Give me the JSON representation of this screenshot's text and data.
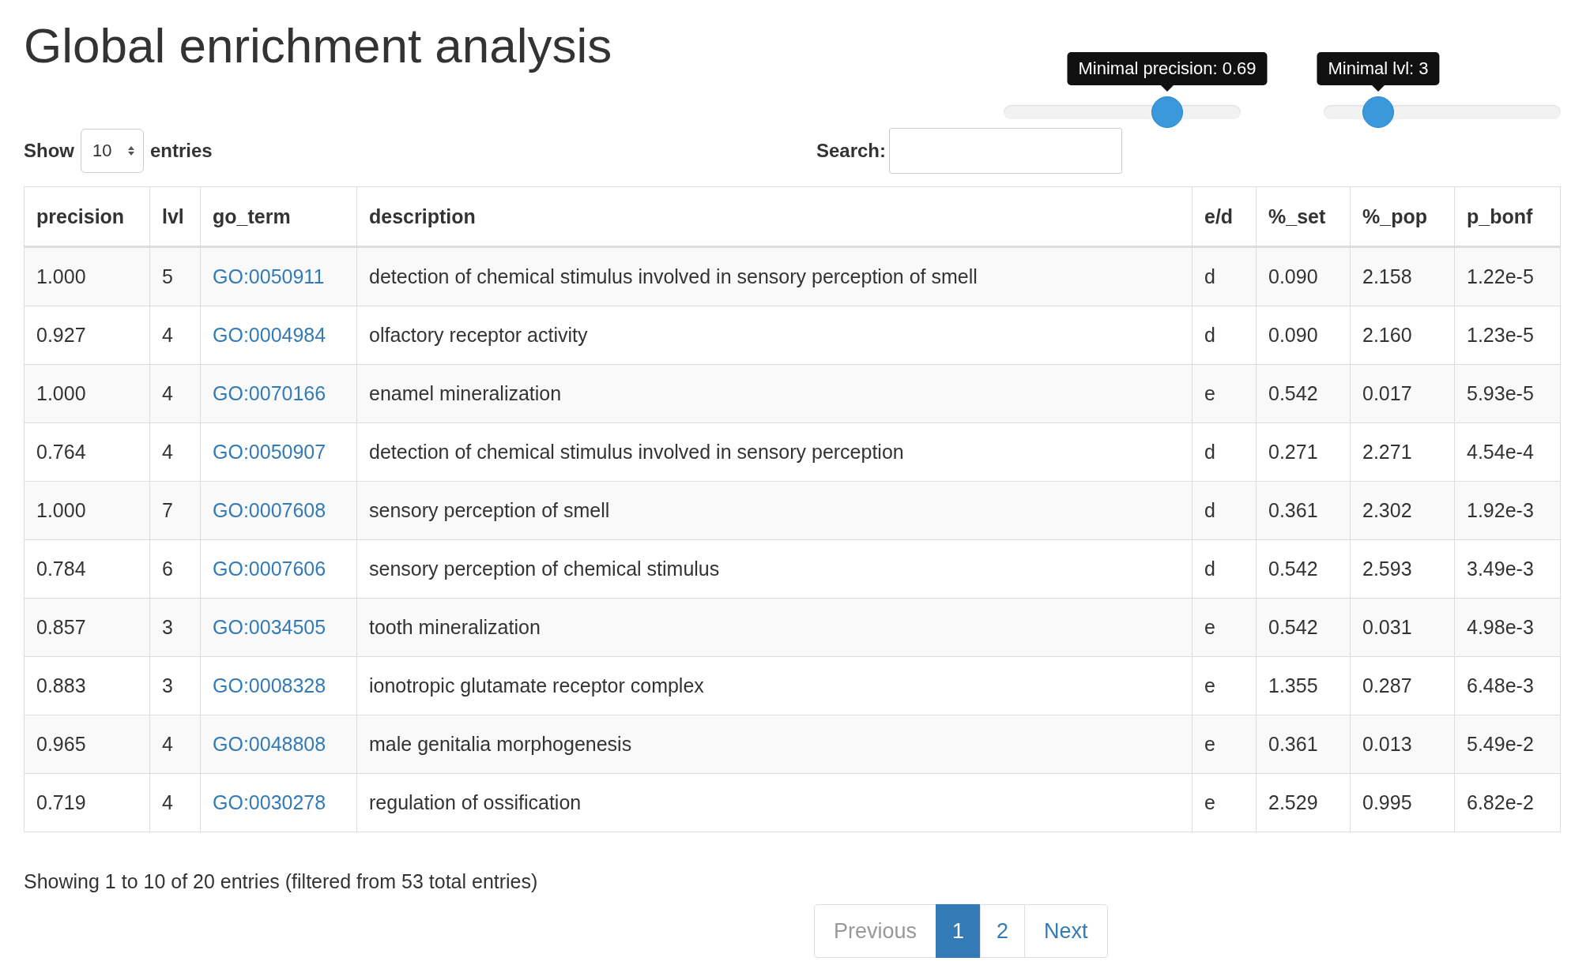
{
  "title": "Global enrichment analysis",
  "sliders": [
    {
      "tooltip": "Minimal precision: 0.69",
      "level": 0.69
    },
    {
      "tooltip": "Minimal lvl: 3",
      "level": 0.23
    }
  ],
  "length_control": {
    "before": "Show",
    "value": "10",
    "after": "entries"
  },
  "search": {
    "label": "Search:"
  },
  "table": {
    "columns": [
      "precision",
      "lvl",
      "go_term",
      "description",
      "e/d",
      "%_set",
      "%_pop",
      "p_bonf"
    ],
    "rows": [
      [
        "1.000",
        "5",
        "GO:0050911",
        "detection of chemical stimulus involved in sensory perception of smell",
        "d",
        "0.090",
        "2.158",
        "1.22e-5"
      ],
      [
        "0.927",
        "4",
        "GO:0004984",
        "olfactory receptor activity",
        "d",
        "0.090",
        "2.160",
        "1.23e-5"
      ],
      [
        "1.000",
        "4",
        "GO:0070166",
        "enamel mineralization",
        "e",
        "0.542",
        "0.017",
        "5.93e-5"
      ],
      [
        "0.764",
        "4",
        "GO:0050907",
        "detection of chemical stimulus involved in sensory perception",
        "d",
        "0.271",
        "2.271",
        "4.54e-4"
      ],
      [
        "1.000",
        "7",
        "GO:0007608",
        "sensory perception of smell",
        "d",
        "0.361",
        "2.302",
        "1.92e-3"
      ],
      [
        "0.784",
        "6",
        "GO:0007606",
        "sensory perception of chemical stimulus",
        "d",
        "0.542",
        "2.593",
        "3.49e-3"
      ],
      [
        "0.857",
        "3",
        "GO:0034505",
        "tooth mineralization",
        "e",
        "0.542",
        "0.031",
        "4.98e-3"
      ],
      [
        "0.883",
        "3",
        "GO:0008328",
        "ionotropic glutamate receptor complex",
        "e",
        "1.355",
        "0.287",
        "6.48e-3"
      ],
      [
        "0.965",
        "4",
        "GO:0048808",
        "male genitalia morphogenesis",
        "e",
        "0.361",
        "0.013",
        "5.49e-2"
      ],
      [
        "0.719",
        "4",
        "GO:0030278",
        "regulation of ossification",
        "e",
        "2.529",
        "0.995",
        "6.82e-2"
      ]
    ]
  },
  "info": "Showing 1 to 10 of 20 entries (filtered from 53 total entries)",
  "pagination": [
    {
      "label": "Previous",
      "kind": "nav",
      "disabled": true,
      "selected": false
    },
    {
      "label": "1",
      "kind": "page",
      "disabled": false,
      "selected": true
    },
    {
      "label": "2",
      "kind": "page",
      "disabled": false,
      "selected": false
    },
    {
      "label": "Next",
      "kind": "nav",
      "disabled": false,
      "selected": false
    }
  ]
}
